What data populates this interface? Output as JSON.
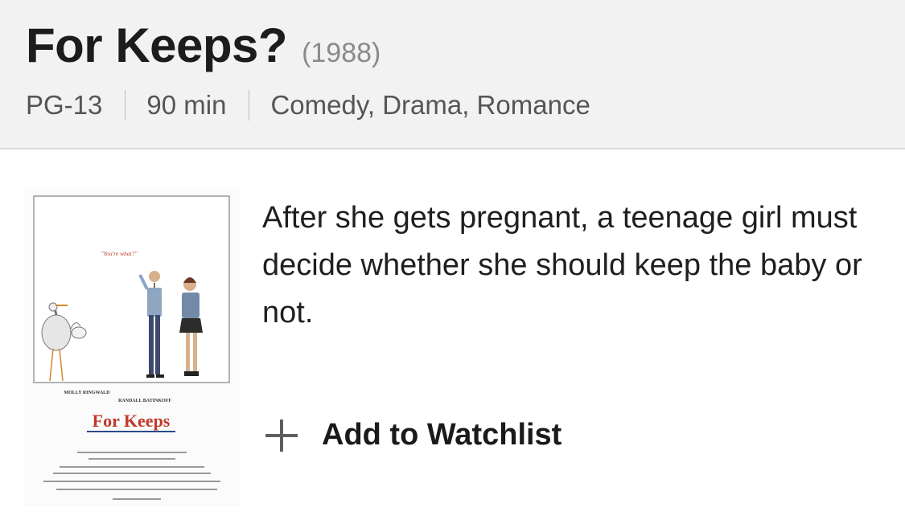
{
  "movie": {
    "title": "For Keeps?",
    "year": "(1988)",
    "rating": "PG-13",
    "runtime": "90 min",
    "genres": "Comedy, Drama, Romance",
    "description": "After she gets pregnant, a teenage girl must decide whether she should keep the baby or not."
  },
  "poster": {
    "tagline": "\"You're what?\"",
    "cast_line_1": "MOLLY RINGWALD",
    "cast_line_2": "RANDALL BATINKOFF",
    "title_text": "For Keeps"
  },
  "actions": {
    "watchlist_label": "Add to Watchlist",
    "watchlist_icon": "plus-icon"
  },
  "colors": {
    "header_bg": "#f2f2f2",
    "poster_title_red": "#c0392b"
  }
}
